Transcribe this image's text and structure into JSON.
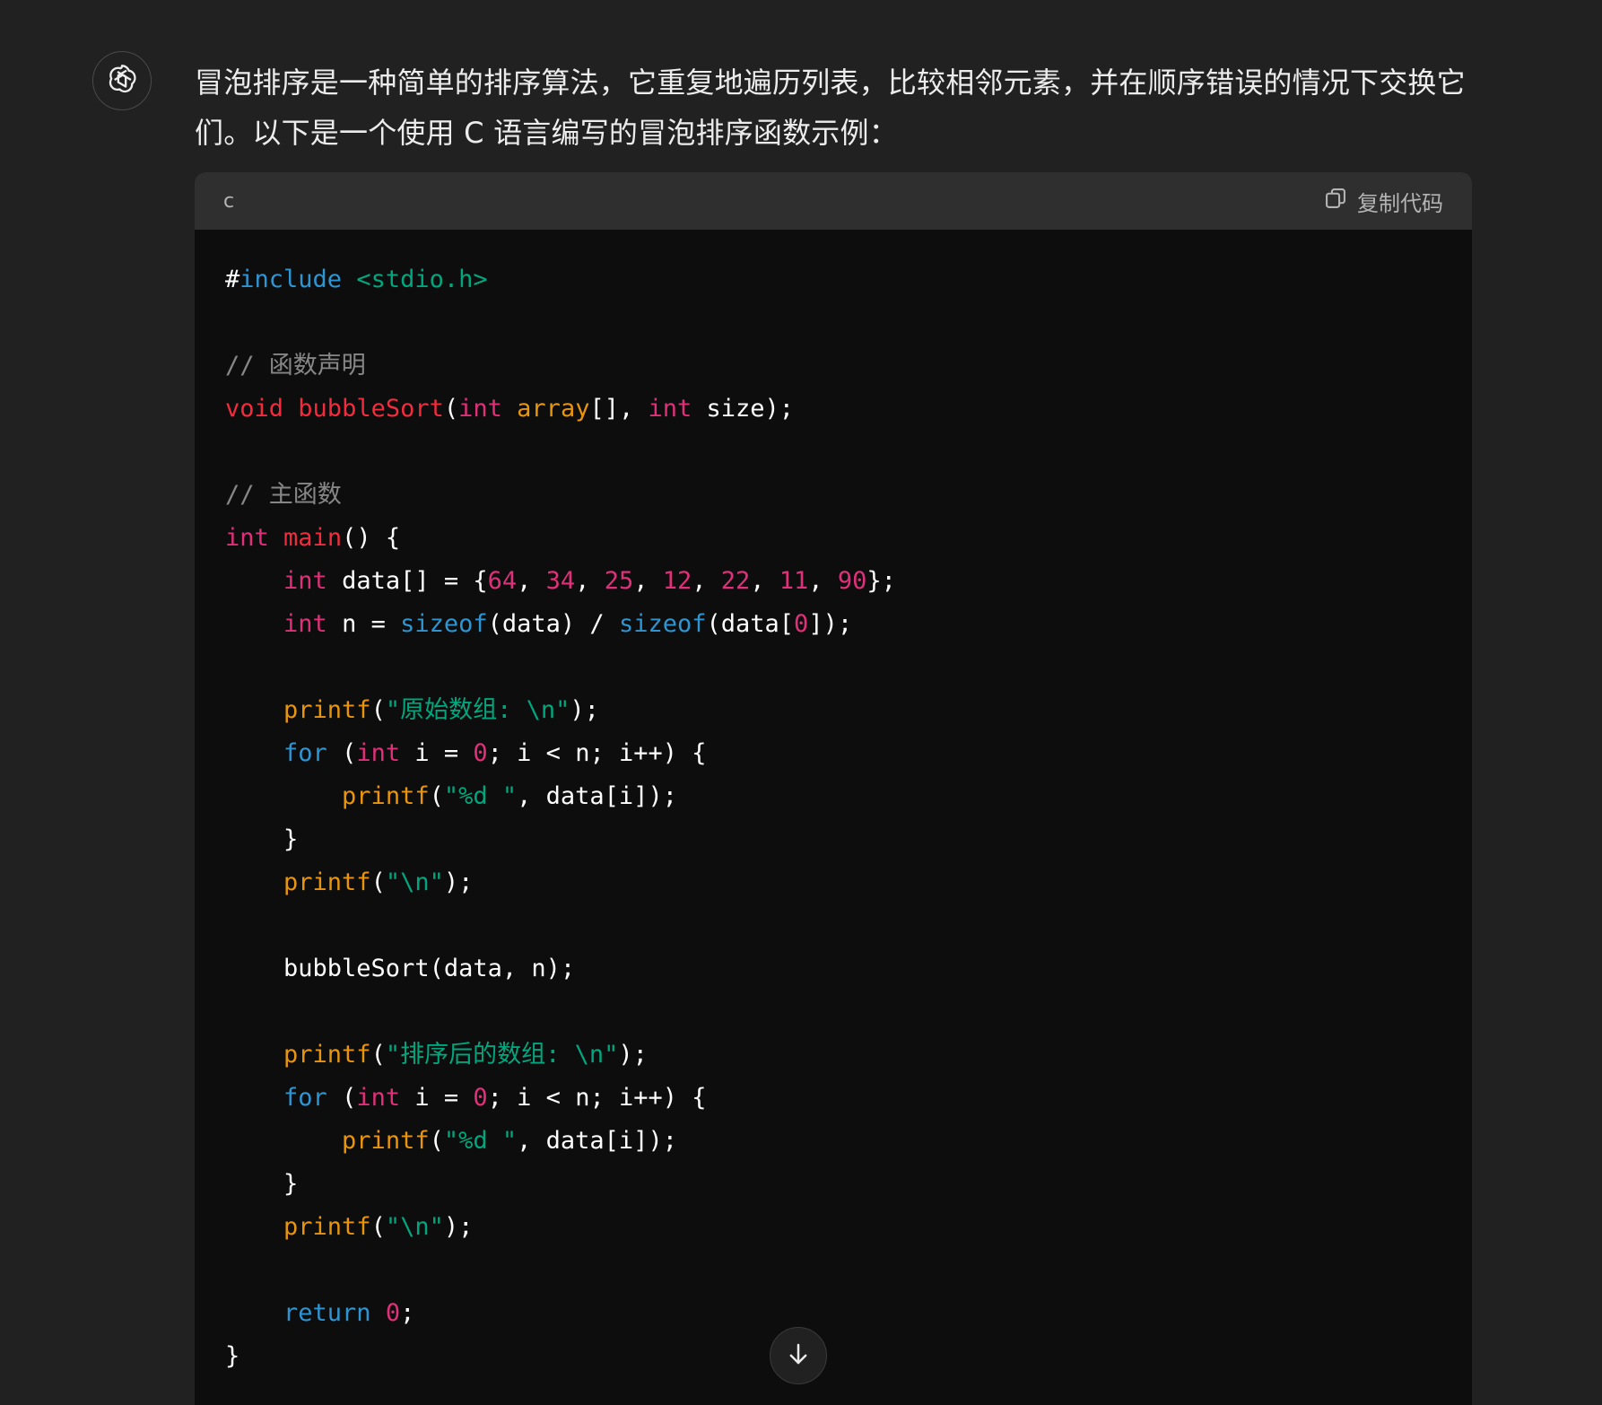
{
  "assistant": {
    "avatar_icon": "openai-logo-icon",
    "message": "冒泡排序是一种简单的排序算法，它重复地遍历列表，比较相邻元素，并在顺序错误的情况下交换它们。以下是一个使用 C 语言编写的冒泡排序函数示例："
  },
  "code_block": {
    "language": "c",
    "copy_label": "复制代码",
    "copy_icon": "copy-icon",
    "lines": [
      [
        {
          "t": "#",
          "c": "plain"
        },
        {
          "t": "include",
          "c": "blue"
        },
        {
          "t": " ",
          "c": "plain"
        },
        {
          "t": "<stdio.h>",
          "c": "green"
        }
      ],
      [],
      [
        {
          "t": "// 函数声明",
          "c": "comment"
        }
      ],
      [
        {
          "t": "void",
          "c": "pink"
        },
        {
          "t": " ",
          "c": "plain"
        },
        {
          "t": "bubbleSort",
          "c": "pink"
        },
        {
          "t": "(",
          "c": "plain"
        },
        {
          "t": "int",
          "c": "type"
        },
        {
          "t": " ",
          "c": "plain"
        },
        {
          "t": "array",
          "c": "orange"
        },
        {
          "t": "[], ",
          "c": "plain"
        },
        {
          "t": "int",
          "c": "type"
        },
        {
          "t": " size);",
          "c": "plain"
        }
      ],
      [],
      [
        {
          "t": "// 主函数",
          "c": "comment"
        }
      ],
      [
        {
          "t": "int",
          "c": "type"
        },
        {
          "t": " ",
          "c": "plain"
        },
        {
          "t": "main",
          "c": "pink"
        },
        {
          "t": "() {",
          "c": "plain"
        }
      ],
      [
        {
          "t": "    ",
          "c": "plain"
        },
        {
          "t": "int",
          "c": "type"
        },
        {
          "t": " data[] = {",
          "c": "plain"
        },
        {
          "t": "64",
          "c": "num"
        },
        {
          "t": ", ",
          "c": "plain"
        },
        {
          "t": "34",
          "c": "num"
        },
        {
          "t": ", ",
          "c": "plain"
        },
        {
          "t": "25",
          "c": "num"
        },
        {
          "t": ", ",
          "c": "plain"
        },
        {
          "t": "12",
          "c": "num"
        },
        {
          "t": ", ",
          "c": "plain"
        },
        {
          "t": "22",
          "c": "num"
        },
        {
          "t": ", ",
          "c": "plain"
        },
        {
          "t": "11",
          "c": "num"
        },
        {
          "t": ", ",
          "c": "plain"
        },
        {
          "t": "90",
          "c": "num"
        },
        {
          "t": "};",
          "c": "plain"
        }
      ],
      [
        {
          "t": "    ",
          "c": "plain"
        },
        {
          "t": "int",
          "c": "type"
        },
        {
          "t": " n = ",
          "c": "plain"
        },
        {
          "t": "sizeof",
          "c": "blue"
        },
        {
          "t": "(data) / ",
          "c": "plain"
        },
        {
          "t": "sizeof",
          "c": "blue"
        },
        {
          "t": "(data[",
          "c": "plain"
        },
        {
          "t": "0",
          "c": "num"
        },
        {
          "t": "]);",
          "c": "plain"
        }
      ],
      [],
      [
        {
          "t": "    ",
          "c": "plain"
        },
        {
          "t": "printf",
          "c": "orange"
        },
        {
          "t": "(",
          "c": "plain"
        },
        {
          "t": "\"原始数组: \\n\"",
          "c": "green"
        },
        {
          "t": ");",
          "c": "plain"
        }
      ],
      [
        {
          "t": "    ",
          "c": "plain"
        },
        {
          "t": "for",
          "c": "blue"
        },
        {
          "t": " (",
          "c": "plain"
        },
        {
          "t": "int",
          "c": "type"
        },
        {
          "t": " i = ",
          "c": "plain"
        },
        {
          "t": "0",
          "c": "num"
        },
        {
          "t": "; i < n; i++) {",
          "c": "plain"
        }
      ],
      [
        {
          "t": "        ",
          "c": "plain"
        },
        {
          "t": "printf",
          "c": "orange"
        },
        {
          "t": "(",
          "c": "plain"
        },
        {
          "t": "\"%d \"",
          "c": "green"
        },
        {
          "t": ", data[i]);",
          "c": "plain"
        }
      ],
      [
        {
          "t": "    }",
          "c": "plain"
        }
      ],
      [
        {
          "t": "    ",
          "c": "plain"
        },
        {
          "t": "printf",
          "c": "orange"
        },
        {
          "t": "(",
          "c": "plain"
        },
        {
          "t": "\"\\n\"",
          "c": "green"
        },
        {
          "t": ");",
          "c": "plain"
        }
      ],
      [],
      [
        {
          "t": "    bubbleSort(data, n);",
          "c": "plain"
        }
      ],
      [],
      [
        {
          "t": "    ",
          "c": "plain"
        },
        {
          "t": "printf",
          "c": "orange"
        },
        {
          "t": "(",
          "c": "plain"
        },
        {
          "t": "\"排序后的数组: \\n\"",
          "c": "green"
        },
        {
          "t": ");",
          "c": "plain"
        }
      ],
      [
        {
          "t": "    ",
          "c": "plain"
        },
        {
          "t": "for",
          "c": "blue"
        },
        {
          "t": " (",
          "c": "plain"
        },
        {
          "t": "int",
          "c": "type"
        },
        {
          "t": " i = ",
          "c": "plain"
        },
        {
          "t": "0",
          "c": "num"
        },
        {
          "t": "; i < n; i++) {",
          "c": "plain"
        }
      ],
      [
        {
          "t": "        ",
          "c": "plain"
        },
        {
          "t": "printf",
          "c": "orange"
        },
        {
          "t": "(",
          "c": "plain"
        },
        {
          "t": "\"%d \"",
          "c": "green"
        },
        {
          "t": ", data[i]);",
          "c": "plain"
        }
      ],
      [
        {
          "t": "    }",
          "c": "plain"
        }
      ],
      [
        {
          "t": "    ",
          "c": "plain"
        },
        {
          "t": "printf",
          "c": "orange"
        },
        {
          "t": "(",
          "c": "plain"
        },
        {
          "t": "\"\\n\"",
          "c": "green"
        },
        {
          "t": ");",
          "c": "plain"
        }
      ],
      [],
      [
        {
          "t": "    ",
          "c": "plain"
        },
        {
          "t": "return",
          "c": "blue"
        },
        {
          "t": " ",
          "c": "plain"
        },
        {
          "t": "0",
          "c": "num"
        },
        {
          "t": ";",
          "c": "plain"
        }
      ],
      [
        {
          "t": "}",
          "c": "plain"
        }
      ]
    ]
  },
  "scroll_button": {
    "icon": "arrow-down-icon"
  },
  "colors": {
    "background": "#212121",
    "code_background": "#0d0d0d",
    "code_header": "#2f2f2f",
    "keyword_pink": "#f22c3d",
    "keyword_type": "#df3079",
    "keyword_blue": "#2e95d3",
    "function_orange": "#e9950c",
    "string_green": "#00a67d"
  }
}
